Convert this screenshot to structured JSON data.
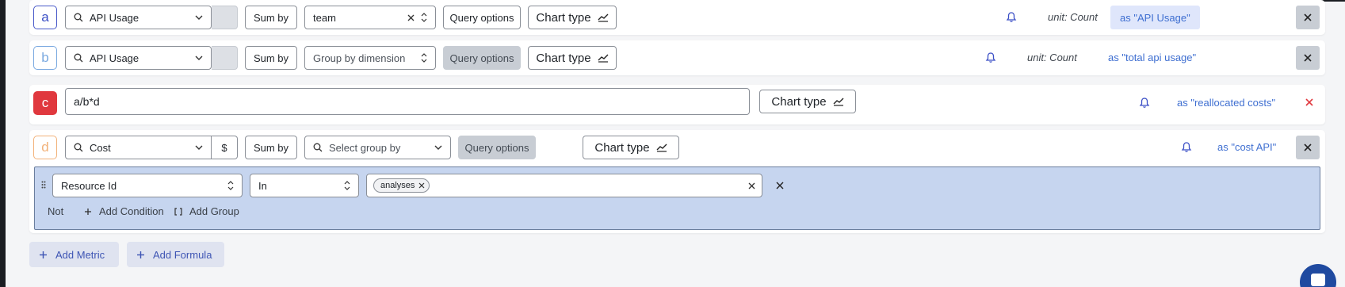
{
  "queries": [
    {
      "letter": "a",
      "metric": "API Usage",
      "sum_by": "Sum by",
      "group_by": "team",
      "query_options": "Query options",
      "chart_type": "Chart type",
      "unit": "unit: Count",
      "alias": "as \"API Usage\""
    },
    {
      "letter": "b",
      "metric": "API Usage",
      "sum_by": "Sum by",
      "group_by_placeholder": "Group by dimension",
      "query_options": "Query options",
      "chart_type": "Chart type",
      "unit": "unit: Count",
      "alias": "as \"total api usage\""
    }
  ],
  "formula": {
    "letter": "c",
    "expression": "a/b*d",
    "chart_type": "Chart type",
    "alias": "as \"reallocated costs\""
  },
  "cost_query": {
    "letter": "d",
    "metric": "Cost",
    "currency": "$",
    "sum_by": "Sum by",
    "group_by_placeholder": "Select group by",
    "query_options": "Query options",
    "chart_type": "Chart type",
    "alias": "as \"cost API\"",
    "filter": {
      "field": "Resource Id",
      "operator": "In",
      "values": [
        "analyses"
      ],
      "not_label": "Not",
      "add_condition": "Add Condition",
      "add_group": "Add Group"
    }
  },
  "actions": {
    "add_metric": "Add Metric",
    "add_formula": "Add Formula"
  },
  "colors": {
    "accent": "#3b4fc6",
    "filter_bg": "#c6d5ef",
    "formula_red": "#e0383e"
  }
}
